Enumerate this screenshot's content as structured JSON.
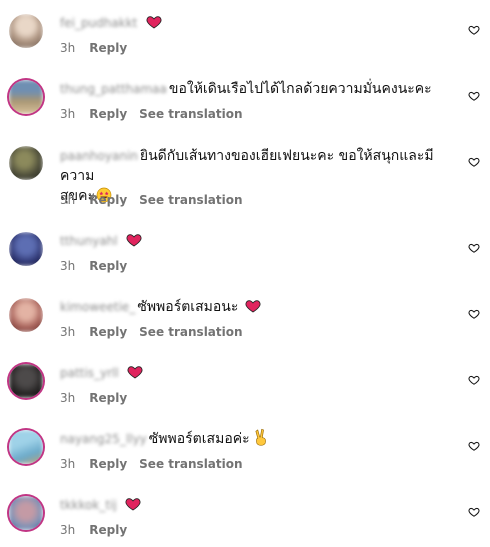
{
  "colors": {
    "heart": "#e0245e",
    "meta_text": "#737373",
    "username_text": "#8e8e8e"
  },
  "icons": {
    "like": "heart-outline-icon",
    "heart_emoji": "red-heart-emoji",
    "face_emoji": "star-struck-emoji",
    "hand_emoji": "victory-hand-emoji"
  },
  "labels": {
    "reply": "Reply",
    "see_translation": "See translation"
  },
  "comments": [
    {
      "username": "fei_pudhakkt",
      "text": "",
      "emoji": "heart",
      "time": "3h",
      "translation": false
    },
    {
      "username": "thung_patthamaa",
      "text": "ขอให้เดินเรือไปได้ไกลด้วยความมั่นคงนะคะ",
      "emoji": "",
      "time": "3h",
      "translation": true
    },
    {
      "username": "paanhoyanin",
      "text": "ยินดีกับเส้นทางของเฮียเฟยนะคะ ขอให้สนุกและมีความ",
      "text2": "สุขคะ",
      "emoji": "face",
      "time": "3h",
      "translation": true
    },
    {
      "username": "tthunyahl",
      "text": "",
      "emoji": "heart",
      "time": "3h",
      "translation": false
    },
    {
      "username": "kimoweetie_",
      "text": "ซัพพอร์ตเสมอนะ",
      "emoji": "heart",
      "time": "3h",
      "translation": true
    },
    {
      "username": "pattis_yrll",
      "text": "",
      "emoji": "heart",
      "time": "3h",
      "translation": false
    },
    {
      "username": "nayang25_llyy",
      "text": "ซัพพอร์ตเสมอค่ะ",
      "emoji": "hand",
      "time": "3h",
      "translation": true
    },
    {
      "username": "tkkkok_tij",
      "text": "",
      "emoji": "heart",
      "time": "3h",
      "translation": false
    }
  ]
}
